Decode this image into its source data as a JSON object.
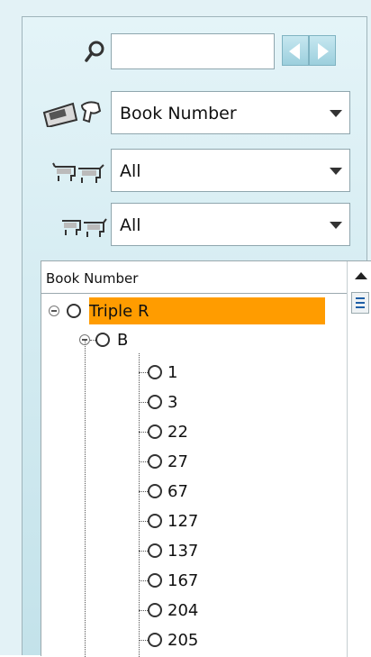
{
  "search": {
    "value": "",
    "placeholder": ""
  },
  "filters": {
    "sort_by": "Book Number",
    "group": "All",
    "status": "All"
  },
  "tree": {
    "header": "Book Number",
    "root": {
      "label": "Triple R"
    },
    "child": {
      "label": "B"
    },
    "leaves": [
      "1",
      "3",
      "22",
      "27",
      "67",
      "127",
      "137",
      "167",
      "204",
      "205"
    ]
  },
  "colors": {
    "highlight": "#ff9c00",
    "panel": "#c3e2ea"
  },
  "icons": [
    "search-icon",
    "prev-icon",
    "next-icon",
    "book-number-tag-icon",
    "cow-herd-icon",
    "cow-group-icon",
    "sort-up-icon"
  ]
}
